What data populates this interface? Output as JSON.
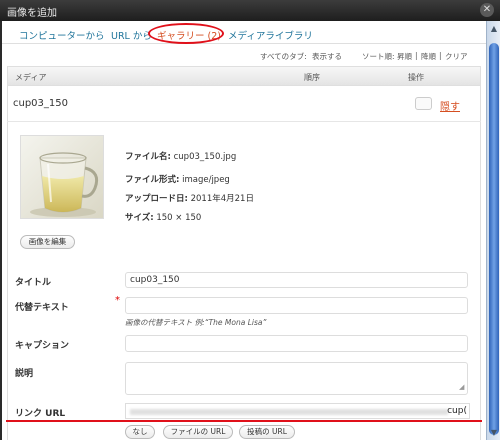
{
  "window": {
    "title": "画像を追加",
    "close_glyph": "✕"
  },
  "tabs": [
    {
      "label": "コンピューターから",
      "active": false
    },
    {
      "label": "URL から",
      "active": false
    },
    {
      "label": "ギャラリー (2)",
      "active": true
    },
    {
      "label": "メディアライブラリ",
      "active": false
    }
  ],
  "sort_bar": {
    "all_tabs_label": "すべてのタブ:",
    "show_link": "表示する",
    "sort_label": "ソート順:",
    "options": [
      "昇順",
      "降順",
      "クリア"
    ],
    "separator": "|"
  },
  "table_header": {
    "media": "メディア",
    "order": "順序",
    "action": "操作"
  },
  "item": {
    "title": "cup03_150",
    "hide_link": "隠す",
    "file_name_label": "ファイル名:",
    "file_name": "cup03_150.jpg",
    "file_type_label": "ファイル形式:",
    "file_type": "image/jpeg",
    "upload_date_label": "アップロード日:",
    "upload_date": "2011年4月21日",
    "size_label": "サイズ:",
    "size": "150 × 150",
    "edit_image_button": "画像を編集"
  },
  "form": {
    "title_label": "タイトル",
    "required_mark": "*",
    "title_value": "cup03_150",
    "alt_label": "代替テキスト",
    "alt_value": "",
    "alt_hint": "画像の代替テキスト 例:“The Mona Lisa”",
    "caption_label": "キャプション",
    "caption_value": "",
    "description_label": "説明",
    "description_value": "",
    "link_url_label": "リンク URL",
    "link_url_visible_tail": "cup(",
    "link_buttons": [
      "なし",
      "ファイルの URL",
      "投稿の URL"
    ]
  },
  "colors": {
    "link": "#21759b",
    "active_tab": "#d54e21",
    "annotation_red": "#e0101a"
  },
  "icons": {
    "scroll_up": "▲",
    "scroll_down": "▼",
    "resize_grip": "◢"
  }
}
